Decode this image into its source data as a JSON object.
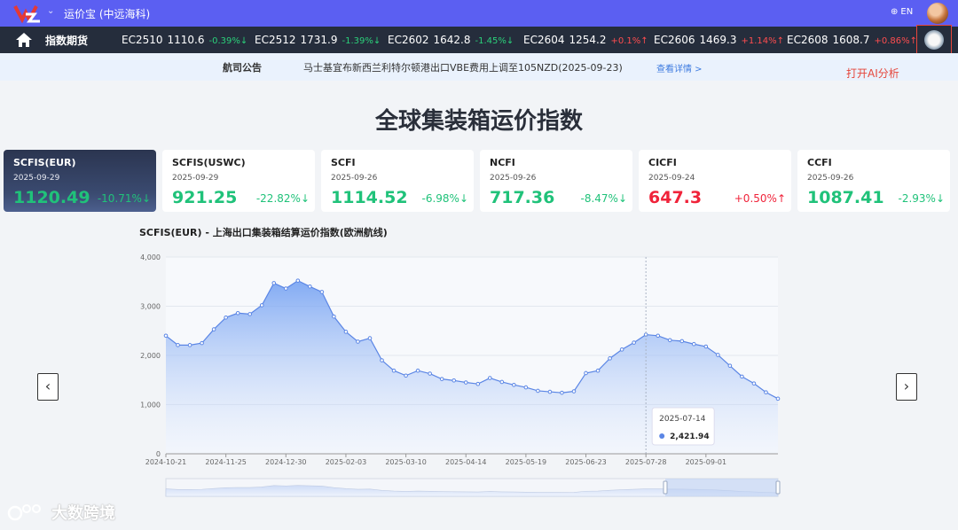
{
  "header": {
    "app_title": "运价宝 (中远海科)",
    "lang": "EN"
  },
  "ticker": {
    "home_label": "指数期货",
    "items": [
      {
        "code": "EC2510",
        "price": "1110.6",
        "change": "-0.39%",
        "dir": "down"
      },
      {
        "code": "EC2512",
        "price": "1731.9",
        "change": "-1.39%",
        "dir": "down"
      },
      {
        "code": "EC2602",
        "price": "1642.8",
        "change": "-1.45%",
        "dir": "down"
      },
      {
        "code": "EC2604",
        "price": "1254.2",
        "change": "+0.1%",
        "dir": "up"
      },
      {
        "code": "EC2606",
        "price": "1469.3",
        "change": "+1.14%",
        "dir": "up"
      },
      {
        "code": "EC2608",
        "price": "1608.7",
        "change": "+0.86%",
        "dir": "up"
      }
    ],
    "ai_tip": "打开AI分析"
  },
  "notice": {
    "label": "航司公告",
    "text": "马士基宜布新西兰利特尔顿港出口VBE费用上调至105NZD(2025-09-23)",
    "link": "查看详情 >"
  },
  "page_title": "全球集装箱运价指数",
  "cards": [
    {
      "name": "SCFIS(EUR)",
      "date": "2025-09-29",
      "value": "1120.49",
      "change": "-10.71%",
      "dir": "down",
      "active": true
    },
    {
      "name": "SCFIS(USWC)",
      "date": "2025-09-29",
      "value": "921.25",
      "change": "-22.82%",
      "dir": "down"
    },
    {
      "name": "SCFI",
      "date": "2025-09-26",
      "value": "1114.52",
      "change": "-6.98%",
      "dir": "down"
    },
    {
      "name": "NCFI",
      "date": "2025-09-26",
      "value": "717.36",
      "change": "-8.47%",
      "dir": "down"
    },
    {
      "name": "CICFI",
      "date": "2025-09-24",
      "value": "647.3",
      "change": "+0.50%",
      "dir": "up"
    },
    {
      "name": "CCFI",
      "date": "2025-09-26",
      "value": "1087.41",
      "change": "-2.93%",
      "dir": "down"
    }
  ],
  "chart_title": "SCFIS(EUR) - 上海出口集装箱结算运价指数(欧洲航线)",
  "chart_data": {
    "type": "area",
    "title": "SCFIS(EUR) - 上海出口集装箱结算运价指数(欧洲航线)",
    "ylim": [
      0,
      4000
    ],
    "yticks": [
      "0",
      "1,000",
      "2,000",
      "3,000",
      "4,000"
    ],
    "ytick_values": [
      0,
      1000,
      2000,
      3000,
      4000
    ],
    "xtick_labels": [
      "2024-10-21",
      "2024-11-25",
      "2024-12-30",
      "2025-02-03",
      "2025-03-10",
      "2025-04-14",
      "2025-05-19",
      "2025-06-23",
      "2025-07-28",
      "2025-09-01"
    ],
    "x_start": "2024-10-14",
    "values": [
      2400,
      2210,
      2210,
      2250,
      2530,
      2770,
      2860,
      2840,
      3020,
      3470,
      3360,
      3520,
      3400,
      3290,
      2790,
      2480,
      2280,
      2350,
      1900,
      1690,
      1590,
      1690,
      1630,
      1520,
      1490,
      1450,
      1420,
      1540,
      1460,
      1400,
      1350,
      1280,
      1260,
      1240,
      1270,
      1640,
      1690,
      1940,
      2120,
      2260,
      2421.94,
      2400,
      2310,
      2290,
      2230,
      2180,
      2010,
      1790,
      1570,
      1430,
      1250,
      1120
    ],
    "tooltip": {
      "date": "2025-07-14",
      "value": "2,421.94"
    },
    "grid": true,
    "legend": "none",
    "color": "#5b86e5"
  }
}
